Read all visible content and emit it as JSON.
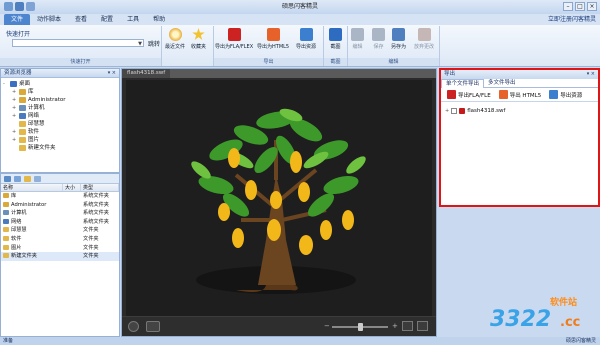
{
  "app": {
    "title": "硕思闪客精灵"
  },
  "menu": {
    "items": [
      "文件",
      "动作脚本",
      "查看",
      "配置",
      "工具",
      "帮助"
    ],
    "active_index": 0,
    "right_link": "立即注册闪客精灵"
  },
  "ribbon": {
    "quick_open_title": "快速打开",
    "quick_open_value": "",
    "go_label": "跳转",
    "groups": {
      "quick_open": "快速打开",
      "export": "导出",
      "capture": "截图",
      "edit": "编辑"
    },
    "buttons": {
      "recent": "最近文件",
      "favorites": "收藏夹",
      "export_fla": "导出为FLA/FLEX",
      "export_html5": "导出为HTML5",
      "export_resource": "导出资源",
      "capture": "截图",
      "edit": "编辑",
      "save": "保存",
      "save_as": "另存为",
      "discard": "放弃更改"
    }
  },
  "resource_browser": {
    "title": "资源浏览器",
    "tree": [
      {
        "label": "桌面",
        "pm": "-",
        "color": "#3a6fc2",
        "indent": 0
      },
      {
        "label": "库",
        "pm": "+",
        "color": "#d9a93a",
        "indent": 1
      },
      {
        "label": "Administrator",
        "pm": "+",
        "color": "#d9a93a",
        "indent": 1
      },
      {
        "label": "计算机",
        "pm": "+",
        "color": "#6a8fb8",
        "indent": 1
      },
      {
        "label": "网络",
        "pm": "+",
        "color": "#4b7bbf",
        "indent": 1
      },
      {
        "label": "邱慧慧",
        "pm": "",
        "color": "#e2b84a",
        "indent": 1
      },
      {
        "label": "软件",
        "pm": "+",
        "color": "#e2b84a",
        "indent": 1
      },
      {
        "label": "图片",
        "pm": "+",
        "color": "#e2b84a",
        "indent": 1
      },
      {
        "label": "新建文件夹",
        "pm": "",
        "color": "#e2b84a",
        "indent": 1
      }
    ]
  },
  "file_list": {
    "columns": [
      "名称",
      "大小",
      "类型"
    ],
    "rows": [
      {
        "name": "库",
        "size": "",
        "type": "系统文件夹",
        "color": "#d9a93a"
      },
      {
        "name": "Administrator",
        "size": "",
        "type": "系统文件夹",
        "color": "#d9a93a"
      },
      {
        "name": "计算机",
        "size": "",
        "type": "系统文件夹",
        "color": "#6a8fb8"
      },
      {
        "name": "网络",
        "size": "",
        "type": "系统文件夹",
        "color": "#4b7bbf"
      },
      {
        "name": "邱慧慧",
        "size": "",
        "type": "文件夹",
        "color": "#e2b84a"
      },
      {
        "name": "软件",
        "size": "",
        "type": "文件夹",
        "color": "#e2b84a"
      },
      {
        "name": "图片",
        "size": "",
        "type": "文件夹",
        "color": "#e2b84a"
      },
      {
        "name": "新建文件夹",
        "size": "",
        "type": "文件夹",
        "color": "#e2b84a",
        "selected": true
      }
    ]
  },
  "canvas": {
    "tab": "flash4318.swf"
  },
  "export_panel": {
    "title": "导出",
    "tabs": [
      "单个文件导出",
      "多文件导出"
    ],
    "active_tab": 0,
    "buttons": {
      "fla": "导出FLA/FLE",
      "html5": "导出 HTML5",
      "resource": "导出资源"
    },
    "file_name": "flash4318.swf"
  },
  "status": {
    "left": "准备",
    "right": "硕思闪客精灵"
  },
  "watermark": {
    "top": "软件站",
    "logo": "3322",
    "suffix": ".cc"
  },
  "colors": {
    "highlight_border": "#e01414",
    "menu_active": "#4d86cf"
  }
}
